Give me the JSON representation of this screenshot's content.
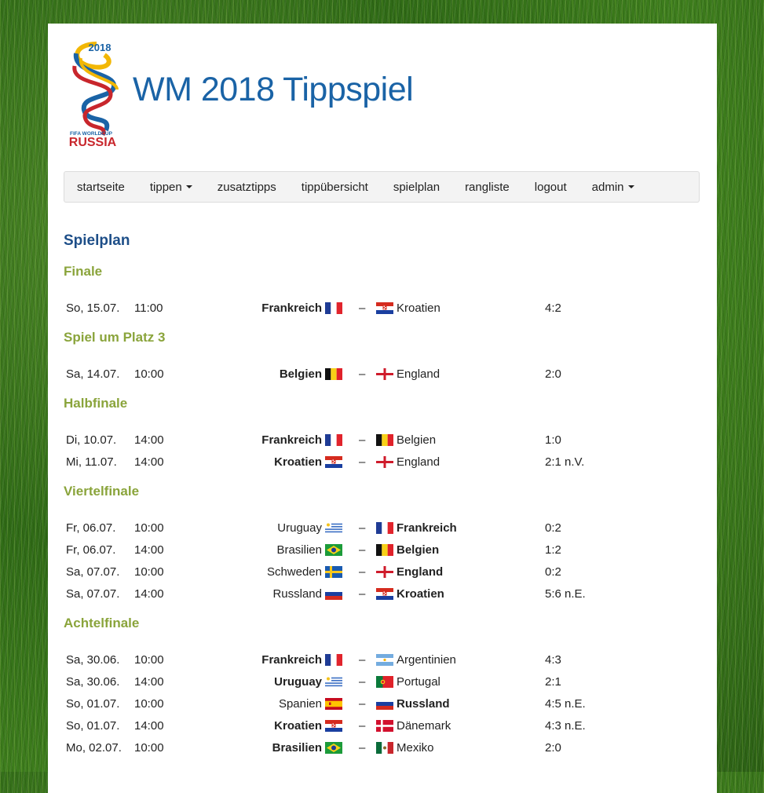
{
  "header": {
    "title": "WM 2018 Tippspiel",
    "logo_year": "2018",
    "logo_line1": "FIFA WORLDCUP",
    "logo_line2": "RUSSIA"
  },
  "nav": {
    "items": [
      {
        "label": "startseite",
        "dropdown": false
      },
      {
        "label": "tippen",
        "dropdown": true
      },
      {
        "label": "zusatztipps",
        "dropdown": false
      },
      {
        "label": "tippübersicht",
        "dropdown": false
      },
      {
        "label": "spielplan",
        "dropdown": false
      },
      {
        "label": "rangliste",
        "dropdown": false
      },
      {
        "label": "logout",
        "dropdown": false
      },
      {
        "label": "admin",
        "dropdown": true
      }
    ]
  },
  "page": {
    "heading": "Spielplan"
  },
  "dash": "–",
  "rounds": [
    {
      "title": "Finale",
      "games": [
        {
          "date": "So, 15.07.",
          "time": "11:00",
          "home": "Frankreich",
          "home_flag": "fr",
          "away": "Kroatien",
          "away_flag": "hr",
          "score": "4:2",
          "winner": "home"
        }
      ]
    },
    {
      "title": "Spiel um Platz 3",
      "games": [
        {
          "date": "Sa, 14.07.",
          "time": "10:00",
          "home": "Belgien",
          "home_flag": "be",
          "away": "England",
          "away_flag": "en",
          "score": "2:0",
          "winner": "home"
        }
      ]
    },
    {
      "title": "Halbfinale",
      "games": [
        {
          "date": "Di, 10.07.",
          "time": "14:00",
          "home": "Frankreich",
          "home_flag": "fr",
          "away": "Belgien",
          "away_flag": "be",
          "score": "1:0",
          "winner": "home"
        },
        {
          "date": "Mi, 11.07.",
          "time": "14:00",
          "home": "Kroatien",
          "home_flag": "hr",
          "away": "England",
          "away_flag": "en",
          "score": "2:1 n.V.",
          "winner": "home"
        }
      ]
    },
    {
      "title": "Viertelfinale",
      "games": [
        {
          "date": "Fr, 06.07.",
          "time": "10:00",
          "home": "Uruguay",
          "home_flag": "uy",
          "away": "Frankreich",
          "away_flag": "fr",
          "score": "0:2",
          "winner": "away"
        },
        {
          "date": "Fr, 06.07.",
          "time": "14:00",
          "home": "Brasilien",
          "home_flag": "br",
          "away": "Belgien",
          "away_flag": "be",
          "score": "1:2",
          "winner": "away"
        },
        {
          "date": "Sa, 07.07.",
          "time": "10:00",
          "home": "Schweden",
          "home_flag": "se",
          "away": "England",
          "away_flag": "en",
          "score": "0:2",
          "winner": "away"
        },
        {
          "date": "Sa, 07.07.",
          "time": "14:00",
          "home": "Russland",
          "home_flag": "ru",
          "away": "Kroatien",
          "away_flag": "hr",
          "score": "5:6 n.E.",
          "winner": "away"
        }
      ]
    },
    {
      "title": "Achtelfinale",
      "games": [
        {
          "date": "Sa, 30.06.",
          "time": "10:00",
          "home": "Frankreich",
          "home_flag": "fr",
          "away": "Argentinien",
          "away_flag": "ar",
          "score": "4:3",
          "winner": "home"
        },
        {
          "date": "Sa, 30.06.",
          "time": "14:00",
          "home": "Uruguay",
          "home_flag": "uy",
          "away": "Portugal",
          "away_flag": "pt",
          "score": "2:1",
          "winner": "home"
        },
        {
          "date": "So, 01.07.",
          "time": "10:00",
          "home": "Spanien",
          "home_flag": "es",
          "away": "Russland",
          "away_flag": "ru",
          "score": "4:5 n.E.",
          "winner": "away"
        },
        {
          "date": "So, 01.07.",
          "time": "14:00",
          "home": "Kroatien",
          "home_flag": "hr",
          "away": "Dänemark",
          "away_flag": "dk",
          "score": "4:3 n.E.",
          "winner": "home"
        },
        {
          "date": "Mo, 02.07.",
          "time": "10:00",
          "home": "Brasilien",
          "home_flag": "br",
          "away": "Mexiko",
          "away_flag": "mx",
          "score": "2:0",
          "winner": "home"
        }
      ]
    }
  ]
}
